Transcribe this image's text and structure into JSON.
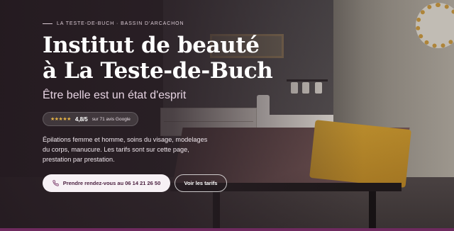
{
  "hero": {
    "eyebrow": "LA TESTE-DE-BUCH · BASSIN D'ARCACHON",
    "title_line1": "Institut de beauté",
    "title_line2": "à La Teste-de-Buch",
    "subtitle": "Être belle est un état d'esprit",
    "rating": {
      "stars": "★★★★★",
      "score": "4,8/5",
      "reviews": "sur 71 avis Google"
    },
    "description": [
      "Épilations femme et homme, soins du visage, modelages",
      "du corps, manucure. Les tarifs sont sur cette page,",
      "prestation par prestation."
    ],
    "cta_primary": "Prendre rendez-vous au 06 14 21 26 50",
    "cta_secondary": "Voir les tarifs"
  },
  "colors": {
    "accent": "#6e2a5e",
    "star": "#e7b445",
    "button_text": "#4b2140"
  },
  "icons": {
    "phone": "phone-icon"
  }
}
